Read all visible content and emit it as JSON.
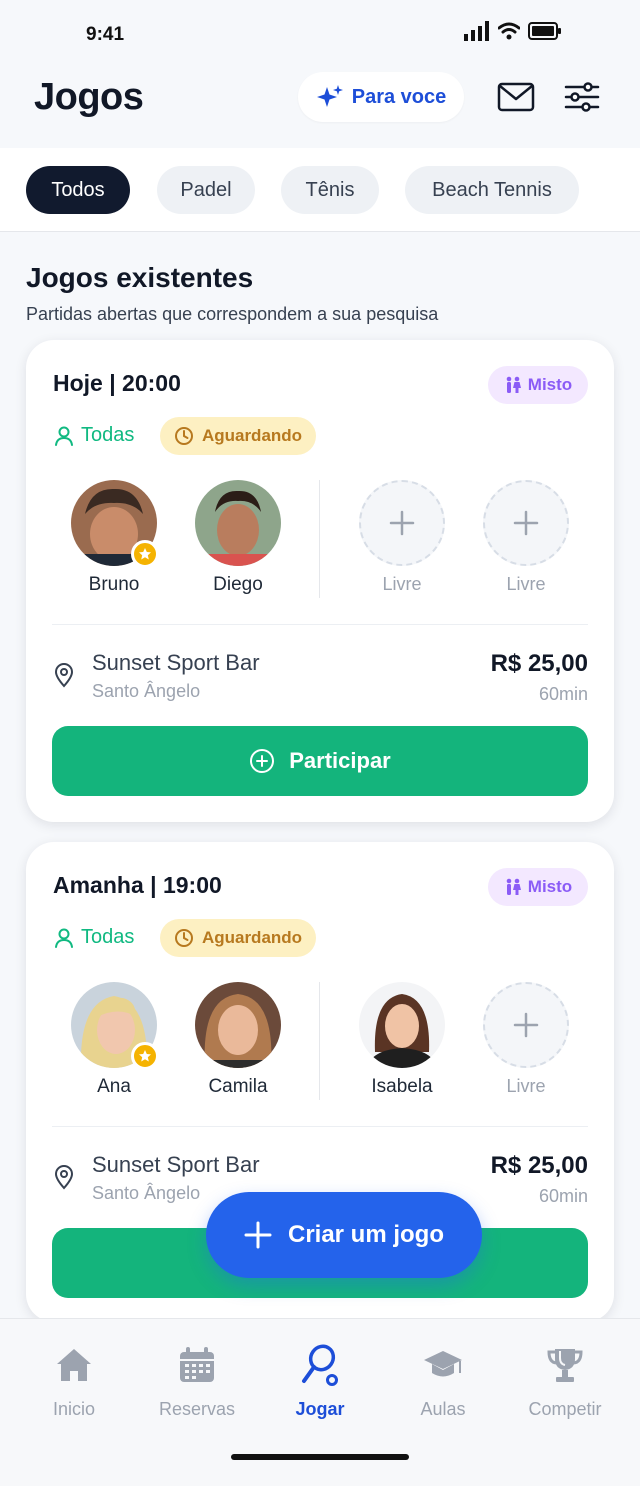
{
  "status_bar": {
    "time": "9:41"
  },
  "header": {
    "title": "Jogos",
    "for_you_label": "Para voce",
    "icons": [
      "sparkle-icon",
      "mail-icon",
      "filter-sliders-icon"
    ]
  },
  "filters": {
    "chips": [
      {
        "label": "Todos",
        "active": true
      },
      {
        "label": "Padel",
        "active": false
      },
      {
        "label": "Tênis",
        "active": false
      },
      {
        "label": "Beach Tennis",
        "active": false
      }
    ]
  },
  "section": {
    "title": "Jogos existentes",
    "subtitle": "Partidas abertas que correspondem a sua pesquisa"
  },
  "games": [
    {
      "datetime": "Hoje | 20:00",
      "type": "Misto",
      "level": "Todas",
      "status": "Aguardando",
      "players": [
        {
          "name": "Bruno",
          "host": true
        },
        {
          "name": "Diego",
          "host": false
        }
      ],
      "free_slots": [
        "Livre",
        "Livre"
      ],
      "venue": "Sunset Sport Bar",
      "city": "Santo Ângelo",
      "price": "R$ 25,00",
      "duration": "60min",
      "action": "Participar"
    },
    {
      "datetime": "Amanha | 19:00",
      "type": "Misto",
      "level": "Todas",
      "status": "Aguardando",
      "players": [
        {
          "name": "Ana",
          "host": true
        },
        {
          "name": "Camila",
          "host": false
        },
        {
          "name": "Isabela",
          "host": false
        }
      ],
      "free_slots": [
        "Livre"
      ],
      "venue": "Sunset Sport Bar",
      "city": "Santo Ângelo",
      "price": "R$ 25,00",
      "duration": "60min"
    }
  ],
  "fab": {
    "label": "Criar um jogo"
  },
  "bottom_nav": [
    {
      "label": "Inicio",
      "icon": "home-icon",
      "active": false
    },
    {
      "label": "Reservas",
      "icon": "calendar-icon",
      "active": false
    },
    {
      "label": "Jogar",
      "icon": "racket-icon",
      "active": true
    },
    {
      "label": "Aulas",
      "icon": "graduation-cap-icon",
      "active": false
    },
    {
      "label": "Competir",
      "icon": "trophy-icon",
      "active": false
    }
  ],
  "colors": {
    "primary_blue": "#2463eb",
    "green": "#14b47c",
    "dark_chip": "#111a2e",
    "purple": "#8b5cf6",
    "amber": "#b7791f"
  }
}
